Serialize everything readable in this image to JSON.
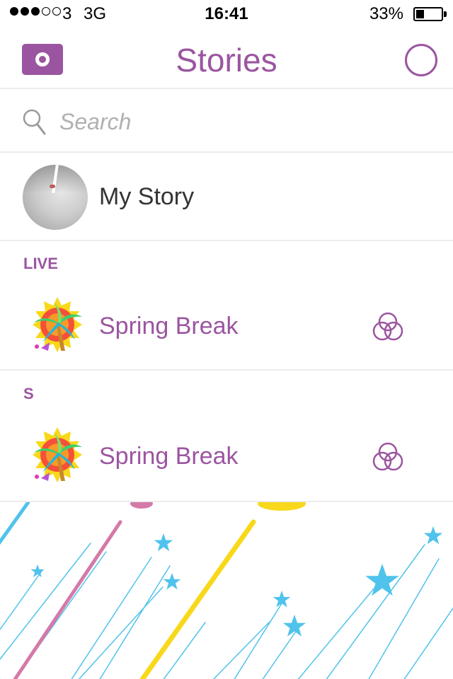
{
  "status_bar": {
    "carrier": "3",
    "network": "3G",
    "time": "16:41",
    "battery_percent": "33%",
    "battery_level": 0.33,
    "signal_bars_filled": 3,
    "signal_bars_total": 5
  },
  "header": {
    "title": "Stories",
    "camera_icon": "camera-icon",
    "right_icon": "circle-icon"
  },
  "search": {
    "placeholder": "Search",
    "value": ""
  },
  "my_story": {
    "label": "My Story"
  },
  "sections": [
    {
      "header": "LIVE",
      "items": [
        {
          "label": "Spring Break",
          "icon": "palm-tree-icon",
          "action_icon": "interlocking-circles-icon"
        }
      ]
    },
    {
      "header": "S",
      "items": [
        {
          "label": "Spring Break",
          "icon": "palm-tree-icon",
          "action_icon": "interlocking-circles-icon"
        }
      ]
    }
  ],
  "colors": {
    "accent": "#9b55a0",
    "divider": "#ececec",
    "star_blue": "#4fc3ec",
    "stripe_pink": "#d47aa8",
    "stripe_yellow": "#f8d81a"
  }
}
